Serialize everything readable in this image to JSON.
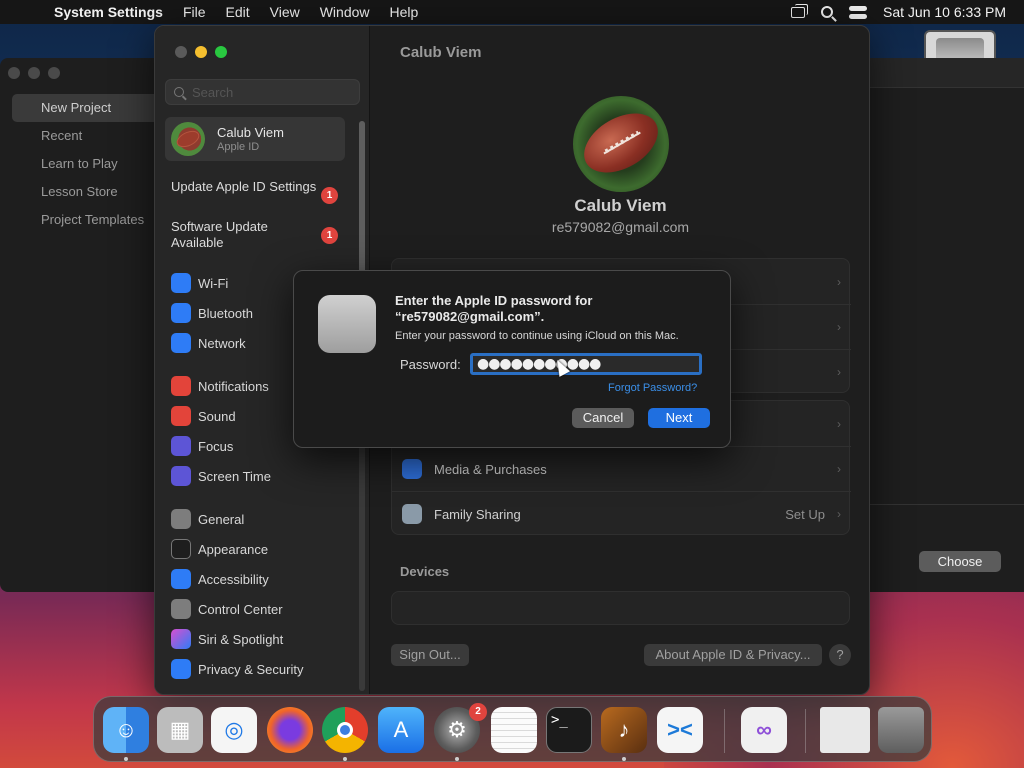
{
  "menubar": {
    "app_name": "System Settings",
    "menus": [
      "File",
      "Edit",
      "View",
      "Window",
      "Help"
    ],
    "clock": "Sat Jun 10  6:33 PM"
  },
  "bg_window": {
    "items": [
      "New Project",
      "Recent",
      "Learn to Play",
      "Lesson Store",
      "Project Templates"
    ],
    "selected": "New Project",
    "choose_label": "Choose"
  },
  "settings": {
    "search_placeholder": "Search",
    "account": {
      "name": "Calub Viem",
      "subtitle": "Apple ID"
    },
    "notices": [
      {
        "label": "Update Apple ID Settings",
        "badge": "1"
      },
      {
        "label": "Software Update Available",
        "badge": "1"
      }
    ],
    "sidebar_items": [
      {
        "label": "Wi-Fi",
        "icon": "wifi-icon"
      },
      {
        "label": "Bluetooth",
        "icon": "bluetooth-icon"
      },
      {
        "label": "Network",
        "icon": "network-icon"
      },
      {
        "label": "Notifications",
        "icon": "notifications-icon"
      },
      {
        "label": "Sound",
        "icon": "sound-icon"
      },
      {
        "label": "Focus",
        "icon": "focus-icon"
      },
      {
        "label": "Screen Time",
        "icon": "screen-time-icon"
      },
      {
        "label": "General",
        "icon": "general-icon"
      },
      {
        "label": "Appearance",
        "icon": "appearance-icon"
      },
      {
        "label": "Accessibility",
        "icon": "accessibility-icon"
      },
      {
        "label": "Control Center",
        "icon": "control-center-icon"
      },
      {
        "label": "Siri & Spotlight",
        "icon": "siri-icon"
      },
      {
        "label": "Privacy & Security",
        "icon": "privacy-icon"
      }
    ],
    "pane": {
      "title": "Calub Viem",
      "user_name": "Calub Viem",
      "user_email": "re579082@gmail.com",
      "rows": [
        {
          "label": "Media & Purchases",
          "trail": ""
        },
        {
          "label": "Family Sharing",
          "trail": "Set Up"
        }
      ],
      "devices_label": "Devices",
      "sign_out_label": "Sign Out...",
      "about_label": "About Apple ID & Privacy...",
      "help_label": "?"
    }
  },
  "dialog": {
    "title": "Enter the Apple ID password for “re579082@gmail.com”.",
    "message": "Enter your password to continue using iCloud on this Mac.",
    "password_label": "Password:",
    "password_value": "●●●●●●●●●●●",
    "forgot_label": "Forgot Password?",
    "cancel_label": "Cancel",
    "next_label": "Next",
    "accent": "#1f6fe0"
  },
  "dock": {
    "apps": [
      {
        "name": "Finder",
        "icon": "finder-icon",
        "running": true
      },
      {
        "name": "Launchpad",
        "icon": "launchpad-icon",
        "running": false
      },
      {
        "name": "Safari",
        "icon": "safari-icon",
        "running": false
      },
      {
        "name": "Firefox",
        "icon": "firefox-icon",
        "running": false
      },
      {
        "name": "Chrome",
        "icon": "chrome-icon",
        "running": true
      },
      {
        "name": "App Store",
        "icon": "app-store-icon",
        "running": false
      },
      {
        "name": "System Settings",
        "icon": "system-settings-icon",
        "running": true,
        "badge": "2"
      },
      {
        "name": "TextEdit",
        "icon": "textedit-icon",
        "running": false
      },
      {
        "name": "Terminal",
        "icon": "terminal-icon",
        "running": false
      },
      {
        "name": "GarageBand",
        "icon": "garageband-icon",
        "running": true
      },
      {
        "name": "Visual Studio Code",
        "icon": "vscode-icon",
        "running": false
      },
      {
        "name": "Visual Studio",
        "icon": "visual-studio-icon",
        "running": false
      },
      {
        "name": "Downloads",
        "icon": "downloads-stack-icon",
        "running": false
      },
      {
        "name": "Trash",
        "icon": "trash-icon",
        "running": false
      }
    ]
  }
}
